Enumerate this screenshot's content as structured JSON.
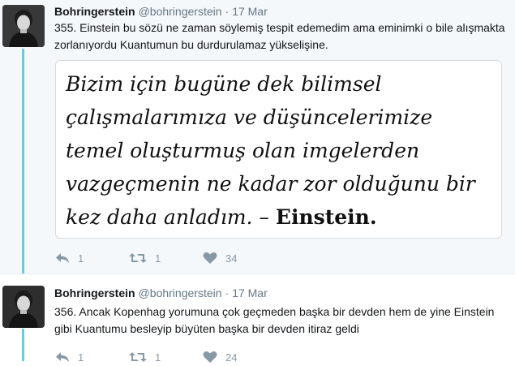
{
  "tweets": [
    {
      "author_name": "Bohringerstein",
      "handle": "@bohringerstein",
      "separator": "·",
      "date": "17 Mar",
      "text": "355. Einstein bu sözü ne zaman söylemiş tespit edemedim ama eminimki o bile alışmakta zorlanıyordu Kuantumun bu durdurulamaz yükselişine.",
      "media": {
        "quote_text": "Bizim için bugüne dek bilimsel çalışmalarımıza ve düşüncelerimize temel oluşturmuş olan imgelerden vazgeçmenin ne kadar zor olduğunu bir kez daha anladım.",
        "quote_dash": " – ",
        "quote_author": "Einstein."
      },
      "reply_count": "1",
      "retweet_count": "1",
      "like_count": "34"
    },
    {
      "author_name": "Bohringerstein",
      "handle": "@bohringerstein",
      "separator": "·",
      "date": "17 Mar",
      "text": "356. Ancak Kopenhag yorumuna çok geçmeden başka bir devden hem de yine Einstein gibi Kuantumu besleyip büyüten başka bir devden itiraz geldi",
      "reply_count": "1",
      "retweet_count": "1",
      "like_count": "24"
    }
  ],
  "icons": {
    "reply": "reply-arrow",
    "retweet": "retweet-arrows",
    "like": "heart"
  },
  "colors": {
    "thread_line": "#5fd0e0",
    "muted_text": "#657786",
    "action_icon": "#8899a6",
    "first_tweet_bg": "#f5f8fa"
  }
}
